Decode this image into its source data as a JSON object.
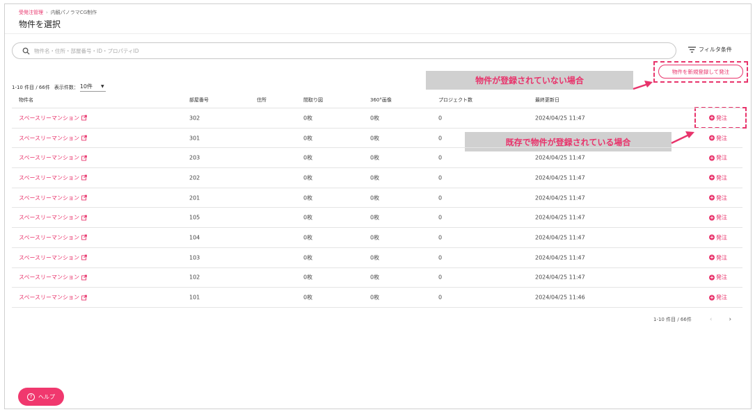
{
  "breadcrumb": {
    "link": "受発注管理",
    "separator": "›",
    "current": "内観パノラマCG制作"
  },
  "page_title": "物件を選択",
  "search": {
    "placeholder": "物件名・住所・部屋番号・ID・プロパティID"
  },
  "filter_label": "フィルタ条件",
  "new_register_button": "物件を新規登録して発注",
  "callouts": {
    "not_registered": "物件が登録されていない場合",
    "already_registered": "既存で物件が登録されている場合"
  },
  "list_count": "1-10 件目 / 66件",
  "per_page": {
    "label": "表示件数：",
    "value": "10件"
  },
  "columns": [
    "物件名",
    "部屋番号",
    "住所",
    "間取り図",
    "360°画像",
    "プロジェクト数",
    "最終更新日"
  ],
  "rows": [
    {
      "name": "スペースリーマンション",
      "room": "302",
      "address": "",
      "floorplan": "0枚",
      "panorama": "0枚",
      "projects": "0",
      "updated": "2024/04/25 11:47",
      "action": "発注"
    },
    {
      "name": "スペースリーマンション",
      "room": "301",
      "address": "",
      "floorplan": "0枚",
      "panorama": "0枚",
      "projects": "0",
      "updated": "",
      "action": "発注"
    },
    {
      "name": "スペースリーマンション",
      "room": "203",
      "address": "",
      "floorplan": "0枚",
      "panorama": "0枚",
      "projects": "0",
      "updated": "2024/04/25 11:47",
      "action": "発注"
    },
    {
      "name": "スペースリーマンション",
      "room": "202",
      "address": "",
      "floorplan": "0枚",
      "panorama": "0枚",
      "projects": "0",
      "updated": "2024/04/25 11:47",
      "action": "発注"
    },
    {
      "name": "スペースリーマンション",
      "room": "201",
      "address": "",
      "floorplan": "0枚",
      "panorama": "0枚",
      "projects": "0",
      "updated": "2024/04/25 11:47",
      "action": "発注"
    },
    {
      "name": "スペースリーマンション",
      "room": "105",
      "address": "",
      "floorplan": "0枚",
      "panorama": "0枚",
      "projects": "0",
      "updated": "2024/04/25 11:47",
      "action": "発注"
    },
    {
      "name": "スペースリーマンション",
      "room": "104",
      "address": "",
      "floorplan": "0枚",
      "panorama": "0枚",
      "projects": "0",
      "updated": "2024/04/25 11:47",
      "action": "発注"
    },
    {
      "name": "スペースリーマンション",
      "room": "103",
      "address": "",
      "floorplan": "0枚",
      "panorama": "0枚",
      "projects": "0",
      "updated": "2024/04/25 11:47",
      "action": "発注"
    },
    {
      "name": "スペースリーマンション",
      "room": "102",
      "address": "",
      "floorplan": "0枚",
      "panorama": "0枚",
      "projects": "0",
      "updated": "2024/04/25 11:47",
      "action": "発注"
    },
    {
      "name": "スペースリーマンション",
      "room": "101",
      "address": "",
      "floorplan": "0枚",
      "panorama": "0枚",
      "projects": "0",
      "updated": "2024/04/25 11:46",
      "action": "発注"
    }
  ],
  "pagination": {
    "range": "1-10 件目 / 66件",
    "prev": "‹",
    "next": "›"
  },
  "help_button": "ヘルプ",
  "colors": {
    "accent": "#e8336b",
    "callout_bg": "#d0d0d0",
    "help_bg": "#f0386e"
  }
}
